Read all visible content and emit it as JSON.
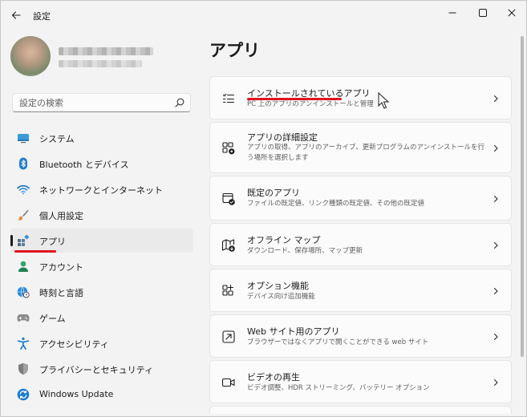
{
  "window": {
    "title": "設定"
  },
  "search": {
    "placeholder": "設定の検索"
  },
  "sidebar": {
    "items": [
      {
        "label": "システム",
        "icon": "monitor-icon"
      },
      {
        "label": "Bluetooth とデバイス",
        "icon": "bluetooth-icon"
      },
      {
        "label": "ネットワークとインターネット",
        "icon": "wifi-icon"
      },
      {
        "label": "個人用設定",
        "icon": "brush-icon"
      },
      {
        "label": "アプリ",
        "icon": "apps-icon",
        "active": true
      },
      {
        "label": "アカウント",
        "icon": "person-icon"
      },
      {
        "label": "時刻と言語",
        "icon": "globe-clock-icon"
      },
      {
        "label": "ゲーム",
        "icon": "gamepad-icon"
      },
      {
        "label": "アクセシビリティ",
        "icon": "accessibility-icon"
      },
      {
        "label": "プライバシーとセキュリティ",
        "icon": "shield-icon"
      },
      {
        "label": "Windows Update",
        "icon": "update-icon"
      }
    ]
  },
  "main": {
    "title": "アプリ",
    "cards": [
      {
        "title": "インストールされているアプリ",
        "subtitle": "PC 上のアプリのアンインストールと管理",
        "icon": "list-icon"
      },
      {
        "title": "アプリの詳細設定",
        "subtitle": "アプリの取得、アプリのアーカイブ、更新プログラムのアンインストールを行う場所を選択します",
        "icon": "apps-gear-icon"
      },
      {
        "title": "既定のアプリ",
        "subtitle": "ファイルの既定値、リンク種類の既定値、その他の既定値",
        "icon": "default-apps-icon"
      },
      {
        "title": "オフライン マップ",
        "subtitle": "ダウンロード、保存場所、マップ更新",
        "icon": "map-download-icon"
      },
      {
        "title": "オプション機能",
        "subtitle": "デバイス向け追加機能",
        "icon": "add-features-icon"
      },
      {
        "title": "Web サイト用のアプリ",
        "subtitle": "ブラウザーではなくアプリで開くことができる web サイト",
        "icon": "open-in-app-icon"
      },
      {
        "title": "ビデオの再生",
        "subtitle": "ビデオ調整、HDR ストリーミング、バッテリー オプション",
        "icon": "video-icon"
      }
    ]
  },
  "colors": {
    "accent": "#0067c0",
    "annotation_red": "#e2121e",
    "background": "#f3f3f3",
    "card": "#fbfbfb"
  }
}
